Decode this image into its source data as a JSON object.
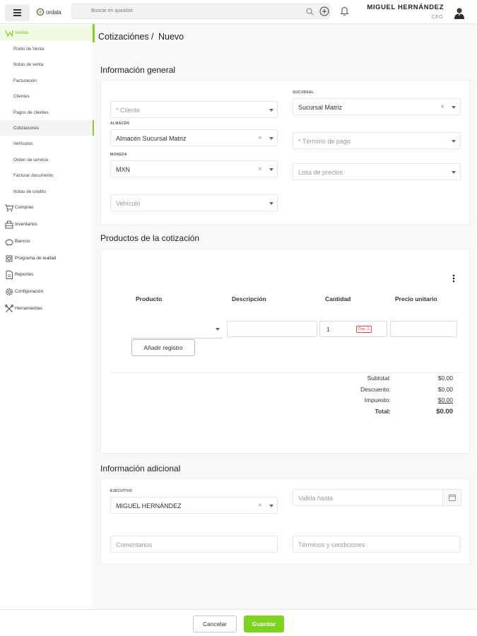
{
  "header": {
    "logo_text": "ordata",
    "search_placeholder": "Buscar en quicklist",
    "user_name": "MIGUEL HERNÁNDEZ",
    "user_role": "CEO"
  },
  "sidebar": {
    "ventas": "Ventas",
    "ventas_items": [
      "Punto de Venta",
      "Notas de venta",
      "Facturación",
      "Clientes",
      "Pagos de clientes",
      "Cotizaciones",
      "Vehículos",
      "Orden de servicio",
      "Facturar documento",
      "Notas de crédito"
    ],
    "groups": [
      "Compras",
      "Inventarios",
      "Bancos",
      "Programa de lealtad",
      "Reportes",
      "Configuración",
      "Herramientas"
    ]
  },
  "page": {
    "breadcrumb_section": "Cotizaciónes /",
    "breadcrumb_current": "Nuevo"
  },
  "general": {
    "title": "Información general",
    "cliente_placeholder": "* Cliente",
    "sucursal_label": "SUCURSAL",
    "sucursal_value": "Sucursal Matriz",
    "almacen_label": "ALMACÉN",
    "almacen_value": "Almacén Sucursal Matriz",
    "termino_placeholder": "* Término de pago",
    "moneda_label": "MONEDA",
    "moneda_value": "MXN",
    "lista_placeholder": "Lista de precios",
    "vehiculo_placeholder": "Vehículo"
  },
  "products": {
    "title": "Productos de la cotización",
    "columns": [
      "Producto",
      "Descripción",
      "Cantidad",
      "Precio unitario"
    ],
    "row": {
      "cantidad": "1",
      "badge": "Disp. 0"
    },
    "add_button": "Añadir registro",
    "totals": [
      {
        "label": "Subtotal:",
        "value": "$0.00"
      },
      {
        "label": "Descuento:",
        "value": "$0.00"
      },
      {
        "label": "Impuesto:",
        "value": "$0.00"
      },
      {
        "label": "Total:",
        "value": "$0.00"
      }
    ]
  },
  "additional": {
    "title": "Información adicional",
    "ejecutivo_label": "EJECUTIVO",
    "ejecutivo_value": "MIGUEL HERNÁNDEZ",
    "valida_placeholder": "Valida hasta",
    "comentarios_placeholder": "Comentarios",
    "terminos_placeholder": "Términos y condiciones"
  },
  "footer": {
    "cancel": "Cancelar",
    "save": "Guardar"
  },
  "colors": {
    "accent": "#7ed321",
    "accent_soft": "#f1fae5",
    "danger": "#e0484b"
  }
}
